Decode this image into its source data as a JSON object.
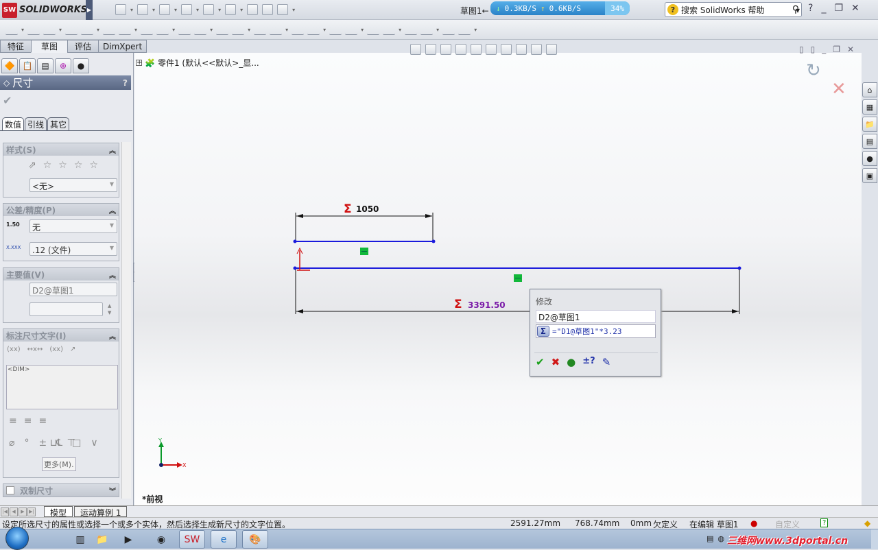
{
  "app": {
    "brand": "SOLIDWORKS",
    "doc_title": "草图1",
    "arrow": "←"
  },
  "net": {
    "down": "0.3KB/S",
    "up": "0.6KB/S",
    "pct": "34%"
  },
  "search": {
    "placeholder": "搜索 SolidWorks 帮助"
  },
  "cm_tabs": [
    {
      "label": "特征"
    },
    {
      "label": "草图",
      "active": true
    },
    {
      "label": "评估"
    },
    {
      "label": "DimXpert"
    }
  ],
  "tree": {
    "root": "零件1 (默认<<默认>_显..."
  },
  "panel": {
    "title": "尺寸",
    "help": "?",
    "tabs": [
      {
        "label": "数值"
      },
      {
        "label": "引线"
      },
      {
        "label": "其它"
      }
    ],
    "style": {
      "header": "样式(S)",
      "value": "<无>"
    },
    "tolerance": {
      "header": "公差/精度(P)",
      "tol_value": "无",
      "precision_value": ".12 (文件)",
      "tol_icon_text": "1.50",
      "prec_icon_text": "X.XXX"
    },
    "primary": {
      "header": "主要值(V)",
      "name": "D2@草图1",
      "value": ""
    },
    "dimtext": {
      "header": "标注尺寸文字(I)",
      "text": "<DIM>",
      "symbols": [
        "⌀",
        "°",
        "±",
        "℄",
        "□",
        "∨",
        "⊔",
        "⊤"
      ],
      "more": "更多(M)."
    },
    "dual": {
      "header": "双制尺寸",
      "checked": false
    }
  },
  "sketch": {
    "dim1": "1050",
    "dim2": "3391.50",
    "sigma": "Σ",
    "colors": {
      "line": "#1a1adc",
      "dim1": "#111111",
      "dim2": "#7a1aa8",
      "sigma": "#d01010",
      "relation": "#12b83a"
    }
  },
  "modify": {
    "title": "修改",
    "name": "D2@草图1",
    "equation": "=\"D1@草图1\"*3.23",
    "sigma": "Σ"
  },
  "view": {
    "name": "*前视",
    "axis_x": "X",
    "axis_y": "Y"
  },
  "bottom_tabs": [
    {
      "label": "模型",
      "active": true
    },
    {
      "label": "运动算例 1"
    }
  ],
  "status": {
    "message": "设定所选尺寸的属性或选择一个或多个实体，然后选择生成新尺寸的文字位置。",
    "x": "2591.27mm",
    "y": "768.74mm",
    "z": "0mm",
    "state": "欠定义",
    "editing": "在编辑 草图1",
    "custom": "自定义"
  },
  "watermark": "三维网www.3dportal.cn"
}
